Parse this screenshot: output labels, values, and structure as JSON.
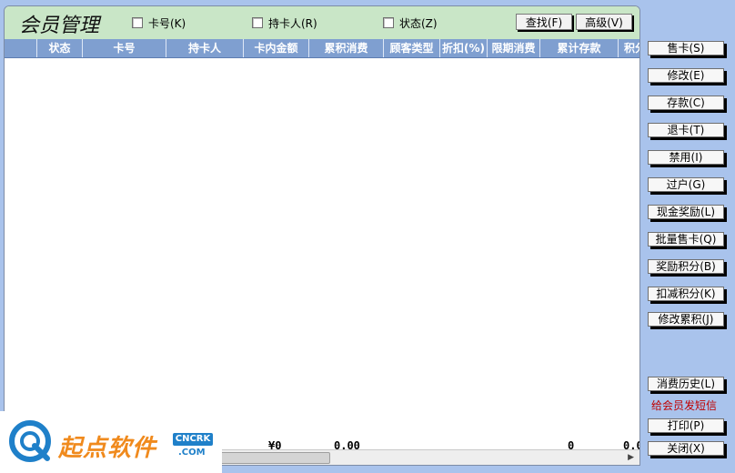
{
  "window": {
    "title": "会员管理"
  },
  "filters": {
    "card_no": "卡号(K)",
    "holder": "持卡人(R)",
    "status": "状态(Z)"
  },
  "header_buttons": {
    "search": "查找(F)",
    "advanced": "高级(V)"
  },
  "columns": [
    "状态",
    "卡号",
    "持卡人",
    "卡内金额",
    "累积消费",
    "顾客类型",
    "折扣(%)",
    "限期消费",
    "累计存款",
    "积分"
  ],
  "totals": {
    "card_amount": "¥0",
    "total_consume": "0.00",
    "total_deposit": "0",
    "points": "0.0"
  },
  "side_buttons": {
    "sell_card": "售卡(S)",
    "modify": "修改(E)",
    "deposit": "存款(C)",
    "refund_card": "退卡(T)",
    "disable": "禁用(I)",
    "transfer": "过户(G)",
    "cash_reward": "现金奖励(L)",
    "bulk_sell": "批量售卡(Q)",
    "reward_points": "奖励积分(B)",
    "deduct_points": "扣减积分(K)",
    "modify_accum": "修改累积(J)",
    "consume_history": "消费历史(L)",
    "sms": "给会员发短信",
    "print": "打印(P)",
    "close": "关闭(X)"
  },
  "watermark": {
    "brand": "起点软件",
    "badge": "CNCRK",
    "sub": ".COM"
  },
  "colors": {
    "background": "#a9c3ec",
    "header": "#c9e6c7",
    "column_header": "#7f9fd0",
    "sms_link": "#c00000"
  }
}
